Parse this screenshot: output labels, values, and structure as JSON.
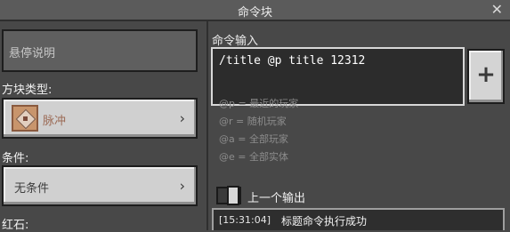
{
  "window": {
    "title": "命令块",
    "close_glyph": "✕"
  },
  "left": {
    "hover_note_placeholder": "悬停说明",
    "block_type_label": "方块类型:",
    "block_type_value": "脉冲",
    "condition_label": "条件:",
    "condition_value": "无条件",
    "redstone_label": "红石:",
    "chevron_glyph": "›"
  },
  "right": {
    "command_input_label": "命令输入",
    "command_text": "/title @p title 12312",
    "add_glyph": "+",
    "selectors": [
      "@p = 最近的玩家",
      "@r = 随机玩家",
      "@a = 全部玩家",
      "@e = 全部实体"
    ],
    "previous_output_label": "上一个输出",
    "output_time": "[15:31:04]",
    "output_message": "标题命令执行成功"
  }
}
